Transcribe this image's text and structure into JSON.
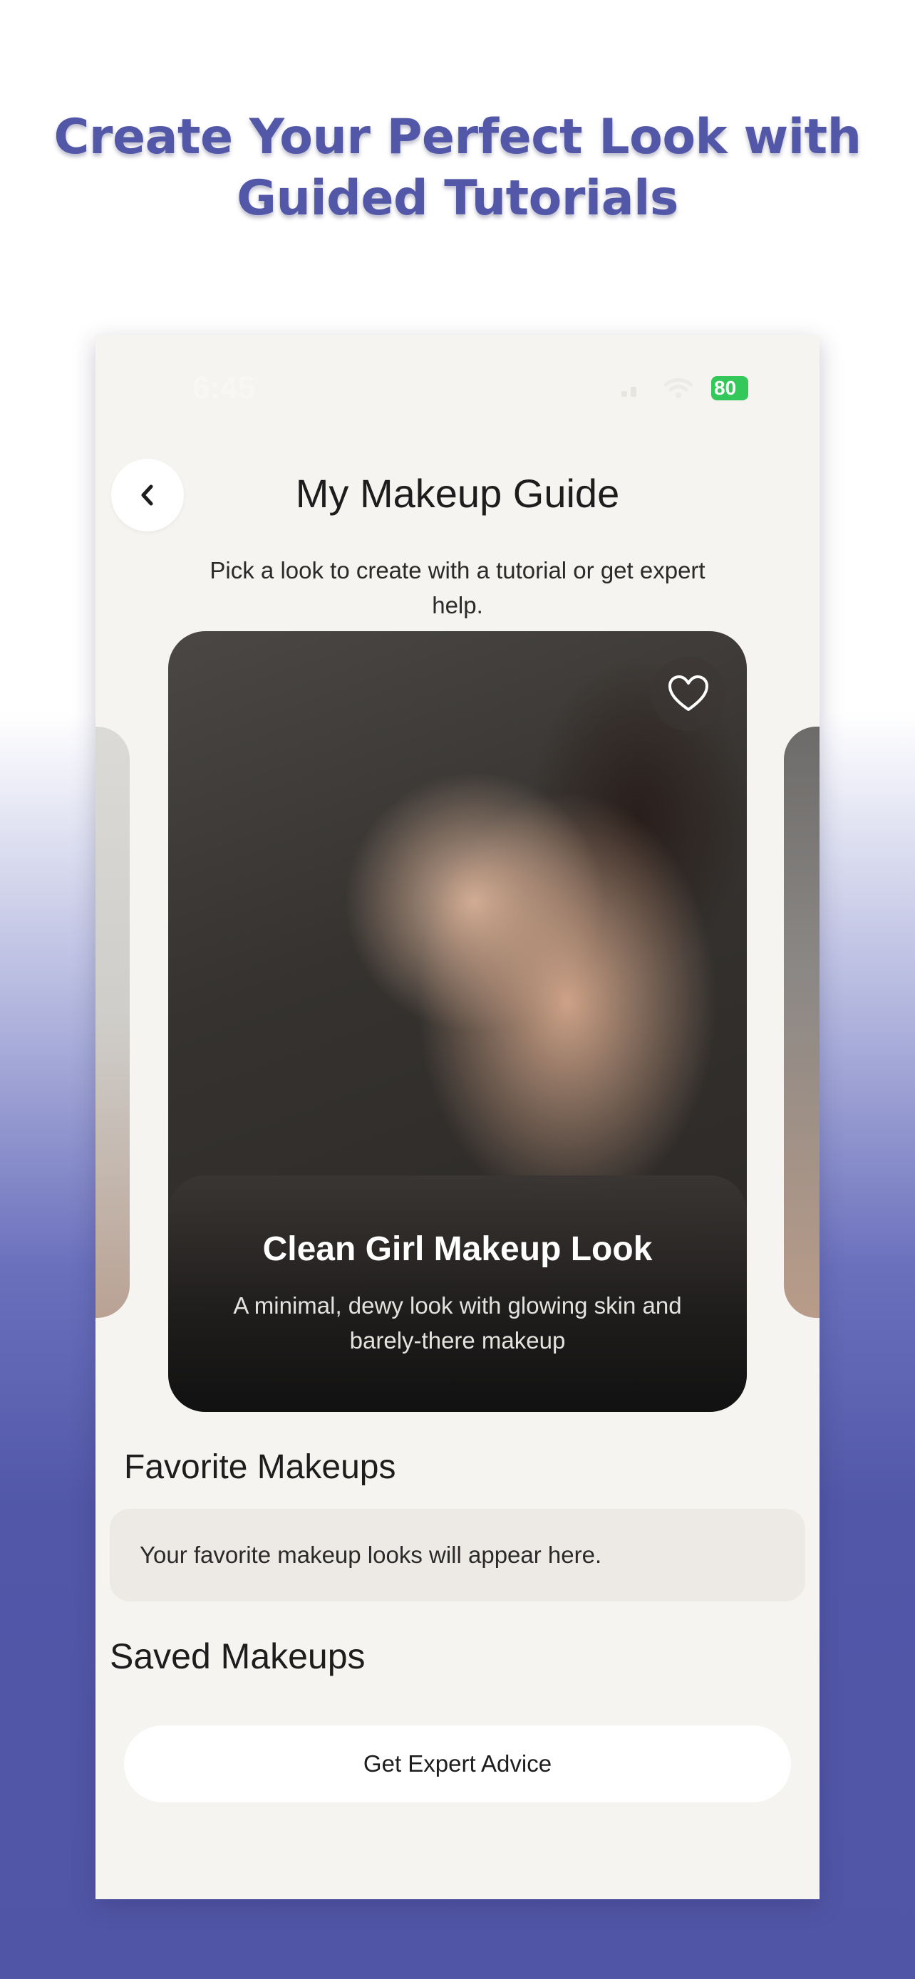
{
  "headline": {
    "line1": "Create Your Perfect Look with",
    "line2": "Guided Tutorials"
  },
  "status_bar": {
    "time": "6:45",
    "battery": "80"
  },
  "header": {
    "title": "My Makeup Guide",
    "back_icon": "chevron-left-icon"
  },
  "subtitle": "Pick a look to create with a tutorial or get expert help.",
  "featured_look": {
    "title": "Clean Girl Makeup Look",
    "description": "A minimal, dewy look with glowing skin and barely-there makeup",
    "favorite_icon": "heart-icon"
  },
  "favorites": {
    "title": "Favorite Makeups",
    "empty_text": "Your favorite makeup looks will appear here."
  },
  "saved": {
    "title": "Saved Makeups"
  },
  "expert_button": {
    "label": "Get Expert Advice"
  },
  "colors": {
    "accent": "#5357a8",
    "background": "#f6f4f0",
    "battery": "#34c759"
  }
}
